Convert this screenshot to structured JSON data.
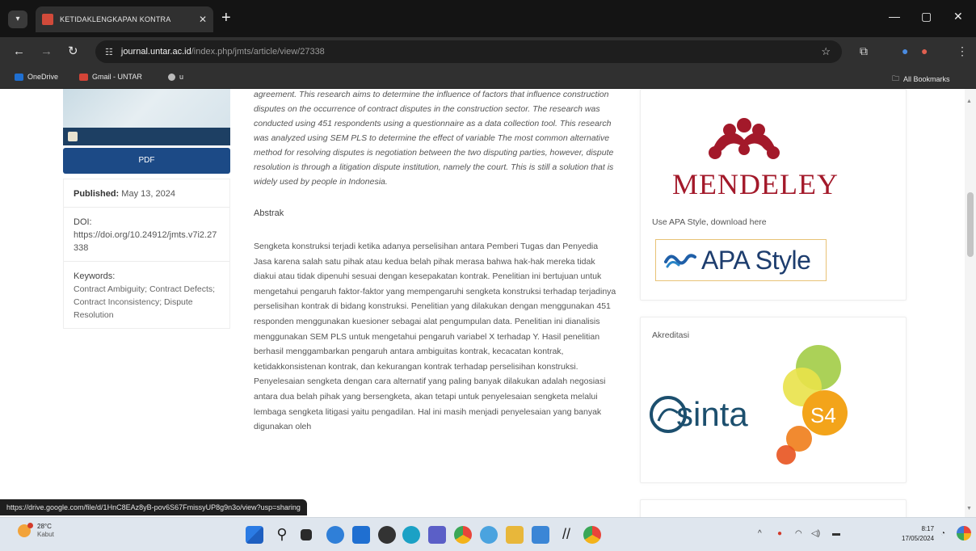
{
  "browser": {
    "tab_title": "KETIDAKLENGKAPAN KONTRA",
    "tab_close": "✕",
    "new_tab": "+",
    "url_host": "journal.untar.ac.id",
    "url_path": "/index.php/jmts/article/view/27338",
    "window": {
      "minimize": "—",
      "maximize": "▢",
      "close": "✕"
    },
    "bookmarks": [
      {
        "label": "OneDrive",
        "color": "#1f6fd1"
      },
      {
        "label": "Gmail - UNTAR",
        "color": "#d34437"
      },
      {
        "label": "u",
        "color": "#bbbbbb"
      }
    ],
    "all_bookmarks": "All Bookmarks"
  },
  "left": {
    "pdf_label": "PDF",
    "published_label": "Published:",
    "published_value": "May 13, 2024",
    "doi_label": "DOI:",
    "doi_value": "https://doi.org/10.24912/jmts.v7i2.27338",
    "keywords_label": "Keywords:",
    "keywords_value": "Contract Ambiguity; Contract Defects; Contract Inconsistency; Dispute Resolution"
  },
  "article": {
    "abstract_en": "agreement. This research aims to determine the influence of factors that influence construction disputes on the occurrence of contract disputes in the construction sector. The research was conducted using 451 respondents using a questionnaire as a data collection tool. This research was analyzed using SEM PLS to determine the effect of variable The most common alternative method for resolving disputes is negotiation between the two disputing parties, however, dispute resolution is through a litigation dispute institution, namely the court. This is still a solution that is widely used by people in Indonesia.",
    "abstrak_heading": "Abstrak",
    "abstrak": "Sengketa konstruksi terjadi ketika adanya perselisihan antara Pemberi Tugas dan Penyedia Jasa karena salah satu pihak atau kedua belah pihak merasa bahwa hak-hak mereka tidak diakui atau tidak dipenuhi sesuai dengan kesepakatan kontrak. Penelitian ini bertujuan untuk mengetahui pengaruh faktor-faktor yang mempengaruhi sengketa konstruksi terhadap terjadinya perselisihan kontrak di bidang konstruksi. Penelitian yang dilakukan dengan menggunakan 451 responden menggunakan kuesioner sebagai alat pengumpulan data. Penelitian ini dianalisis menggunakan SEM PLS untuk mengetahui pengaruh variabel X terhadap Y. Hasil penelitian berhasil menggambarkan pengaruh antara ambiguitas kontrak, kecacatan kontrak, ketidakkonsistenan kontrak, dan kekurangan kontrak terhadap perselisihan konstruksi. Penyelesaian sengketa dengan cara alternatif yang paling banyak dilakukan adalah negosiasi antara dua belah pihak yang bersengketa, akan tetapi untuk penyelesaian sengketa melalui lembaga sengketa litigasi yaitu pengadilan. Hal ini masih menjadi penyelesaian yang banyak digunakan oleh"
  },
  "right": {
    "mendeley_word": "MENDELEY",
    "apa_text": "Use APA Style, download here",
    "apa_logo": "APA Style",
    "akreditasi": "Akreditasi",
    "sinta_word": "sinta",
    "sinta_level": "S4"
  },
  "status_link": "https://drive.google.com/file/d/1HnC8EAz8yB-pov6S67FmissyUP8g9n3o/view?usp=sharing",
  "taskbar": {
    "temp": "28°C",
    "weather": "Kabut",
    "time": "8:17",
    "date": "17/05/2024"
  }
}
